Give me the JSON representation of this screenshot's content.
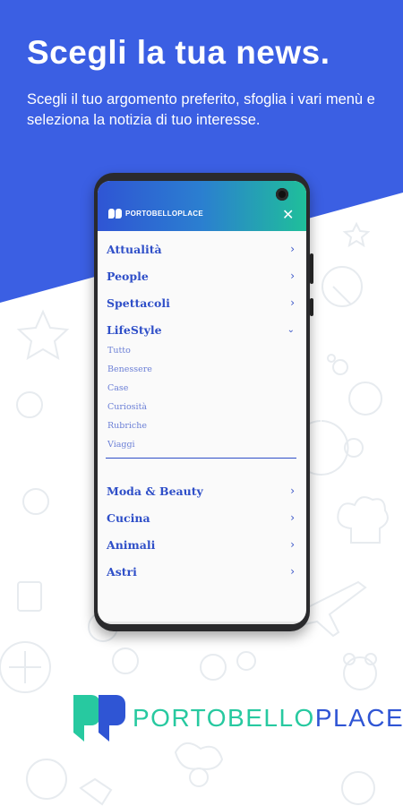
{
  "colors": {
    "brand_blue": "#3b5fe3",
    "brand_teal": "#27c9a0",
    "menu_text": "#2f4fc8",
    "submenu_text": "#6b7fd6"
  },
  "header": {
    "title": "Scegli la tua news.",
    "subtitle": "Scegli il tuo argomento preferito, sfoglia i vari menù e seleziona la notizia di tuo interesse."
  },
  "app": {
    "brand_small": "PORTOBELLOPLACE",
    "close_icon": "close-icon",
    "menu": [
      {
        "label": "Attualità",
        "icon": "chevron-right-icon"
      },
      {
        "label": "People",
        "icon": "chevron-right-icon"
      },
      {
        "label": "Spettacoli",
        "icon": "chevron-right-icon"
      },
      {
        "label": "LifeStyle",
        "icon": "chevron-down-icon"
      }
    ],
    "submenu": [
      "Tutto",
      "Benessere",
      "Case",
      "Curiosità",
      "Rubriche",
      "Viaggi"
    ],
    "menu2": [
      {
        "label": "Moda & Beauty",
        "icon": "chevron-right-icon"
      },
      {
        "label": "Cucina",
        "icon": "chevron-right-icon"
      },
      {
        "label": "Animali",
        "icon": "chevron-right-icon"
      },
      {
        "label": "Astri",
        "icon": "chevron-right-icon"
      }
    ]
  },
  "logo": {
    "word_part1": "PORTOBELLO",
    "word_part2": "PLACE"
  }
}
